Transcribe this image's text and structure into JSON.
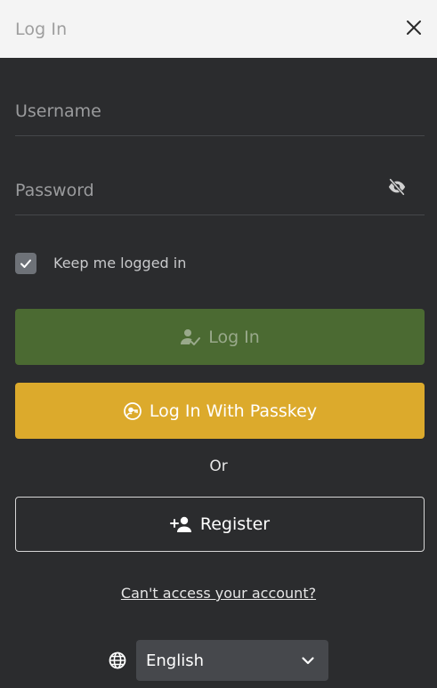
{
  "header": {
    "title": "Log In"
  },
  "form": {
    "username": {
      "placeholder": "Username",
      "value": ""
    },
    "password": {
      "placeholder": "Password",
      "value": ""
    },
    "keep_logged_in": {
      "label": "Keep me logged in",
      "checked": true
    }
  },
  "buttons": {
    "login_label": "Log In",
    "passkey_label": "Log In With Passkey",
    "or_text": "Or",
    "register_label": "Register"
  },
  "links": {
    "cant_access": "Can't access your account?"
  },
  "language": {
    "selected": "English"
  },
  "colors": {
    "header_bg": "#f4f4f4",
    "body_bg": "#2b2c2e",
    "login_green": "#4b6a32",
    "passkey_yellow": "#dcaa2c"
  },
  "icons": {
    "close": "close-icon",
    "eye": "eye-off-icon",
    "check": "check-icon",
    "login": "user-check-icon",
    "passkey": "passkey-icon",
    "register": "user-plus-icon",
    "globe": "globe-icon",
    "chevron": "chevron-down-icon"
  }
}
